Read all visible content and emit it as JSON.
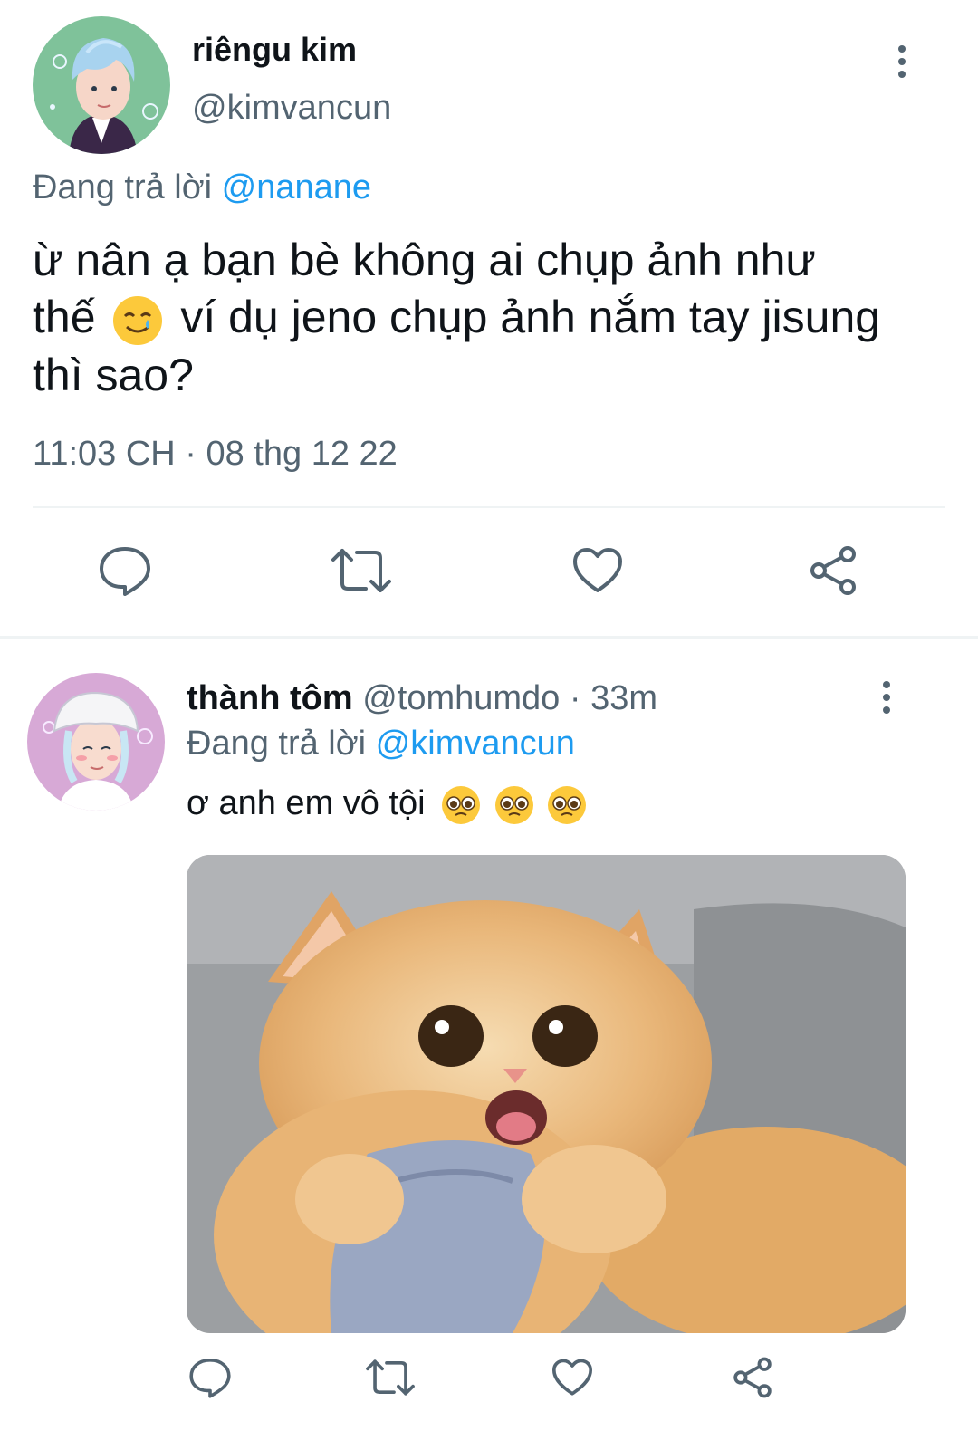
{
  "main_tweet": {
    "display_name": "riêngu kim",
    "handle": "@kimvancun",
    "replying_to_prefix": "Đang trả lời",
    "replying_to_handle": "@nanane",
    "text_line1": "ừ nân ạ bạn bè không ai chụp ảnh như",
    "text_line2_a": "thế",
    "text_line2_b": "ví dụ jeno chụp ảnh nắm tay jisung",
    "text_line3": "thì sao?",
    "timestamp": "11:03 CH · 08 thg 12 22"
  },
  "reply_tweet": {
    "display_name": "thành tôm",
    "handle": "@tomhumdo",
    "separator": "·",
    "time_ago": "33m",
    "replying_to_prefix": "Đang trả lời",
    "replying_to_handle": "@kimvancun",
    "text": "ơ anh em vô tội"
  },
  "icons": {
    "reply": "reply-icon",
    "retweet": "retweet-icon",
    "like": "heart-icon",
    "share": "share-icon",
    "more": "more-vertical-icon"
  },
  "colors": {
    "accent": "#1d9bf0",
    "muted": "#536471",
    "text": "#0f1419"
  }
}
